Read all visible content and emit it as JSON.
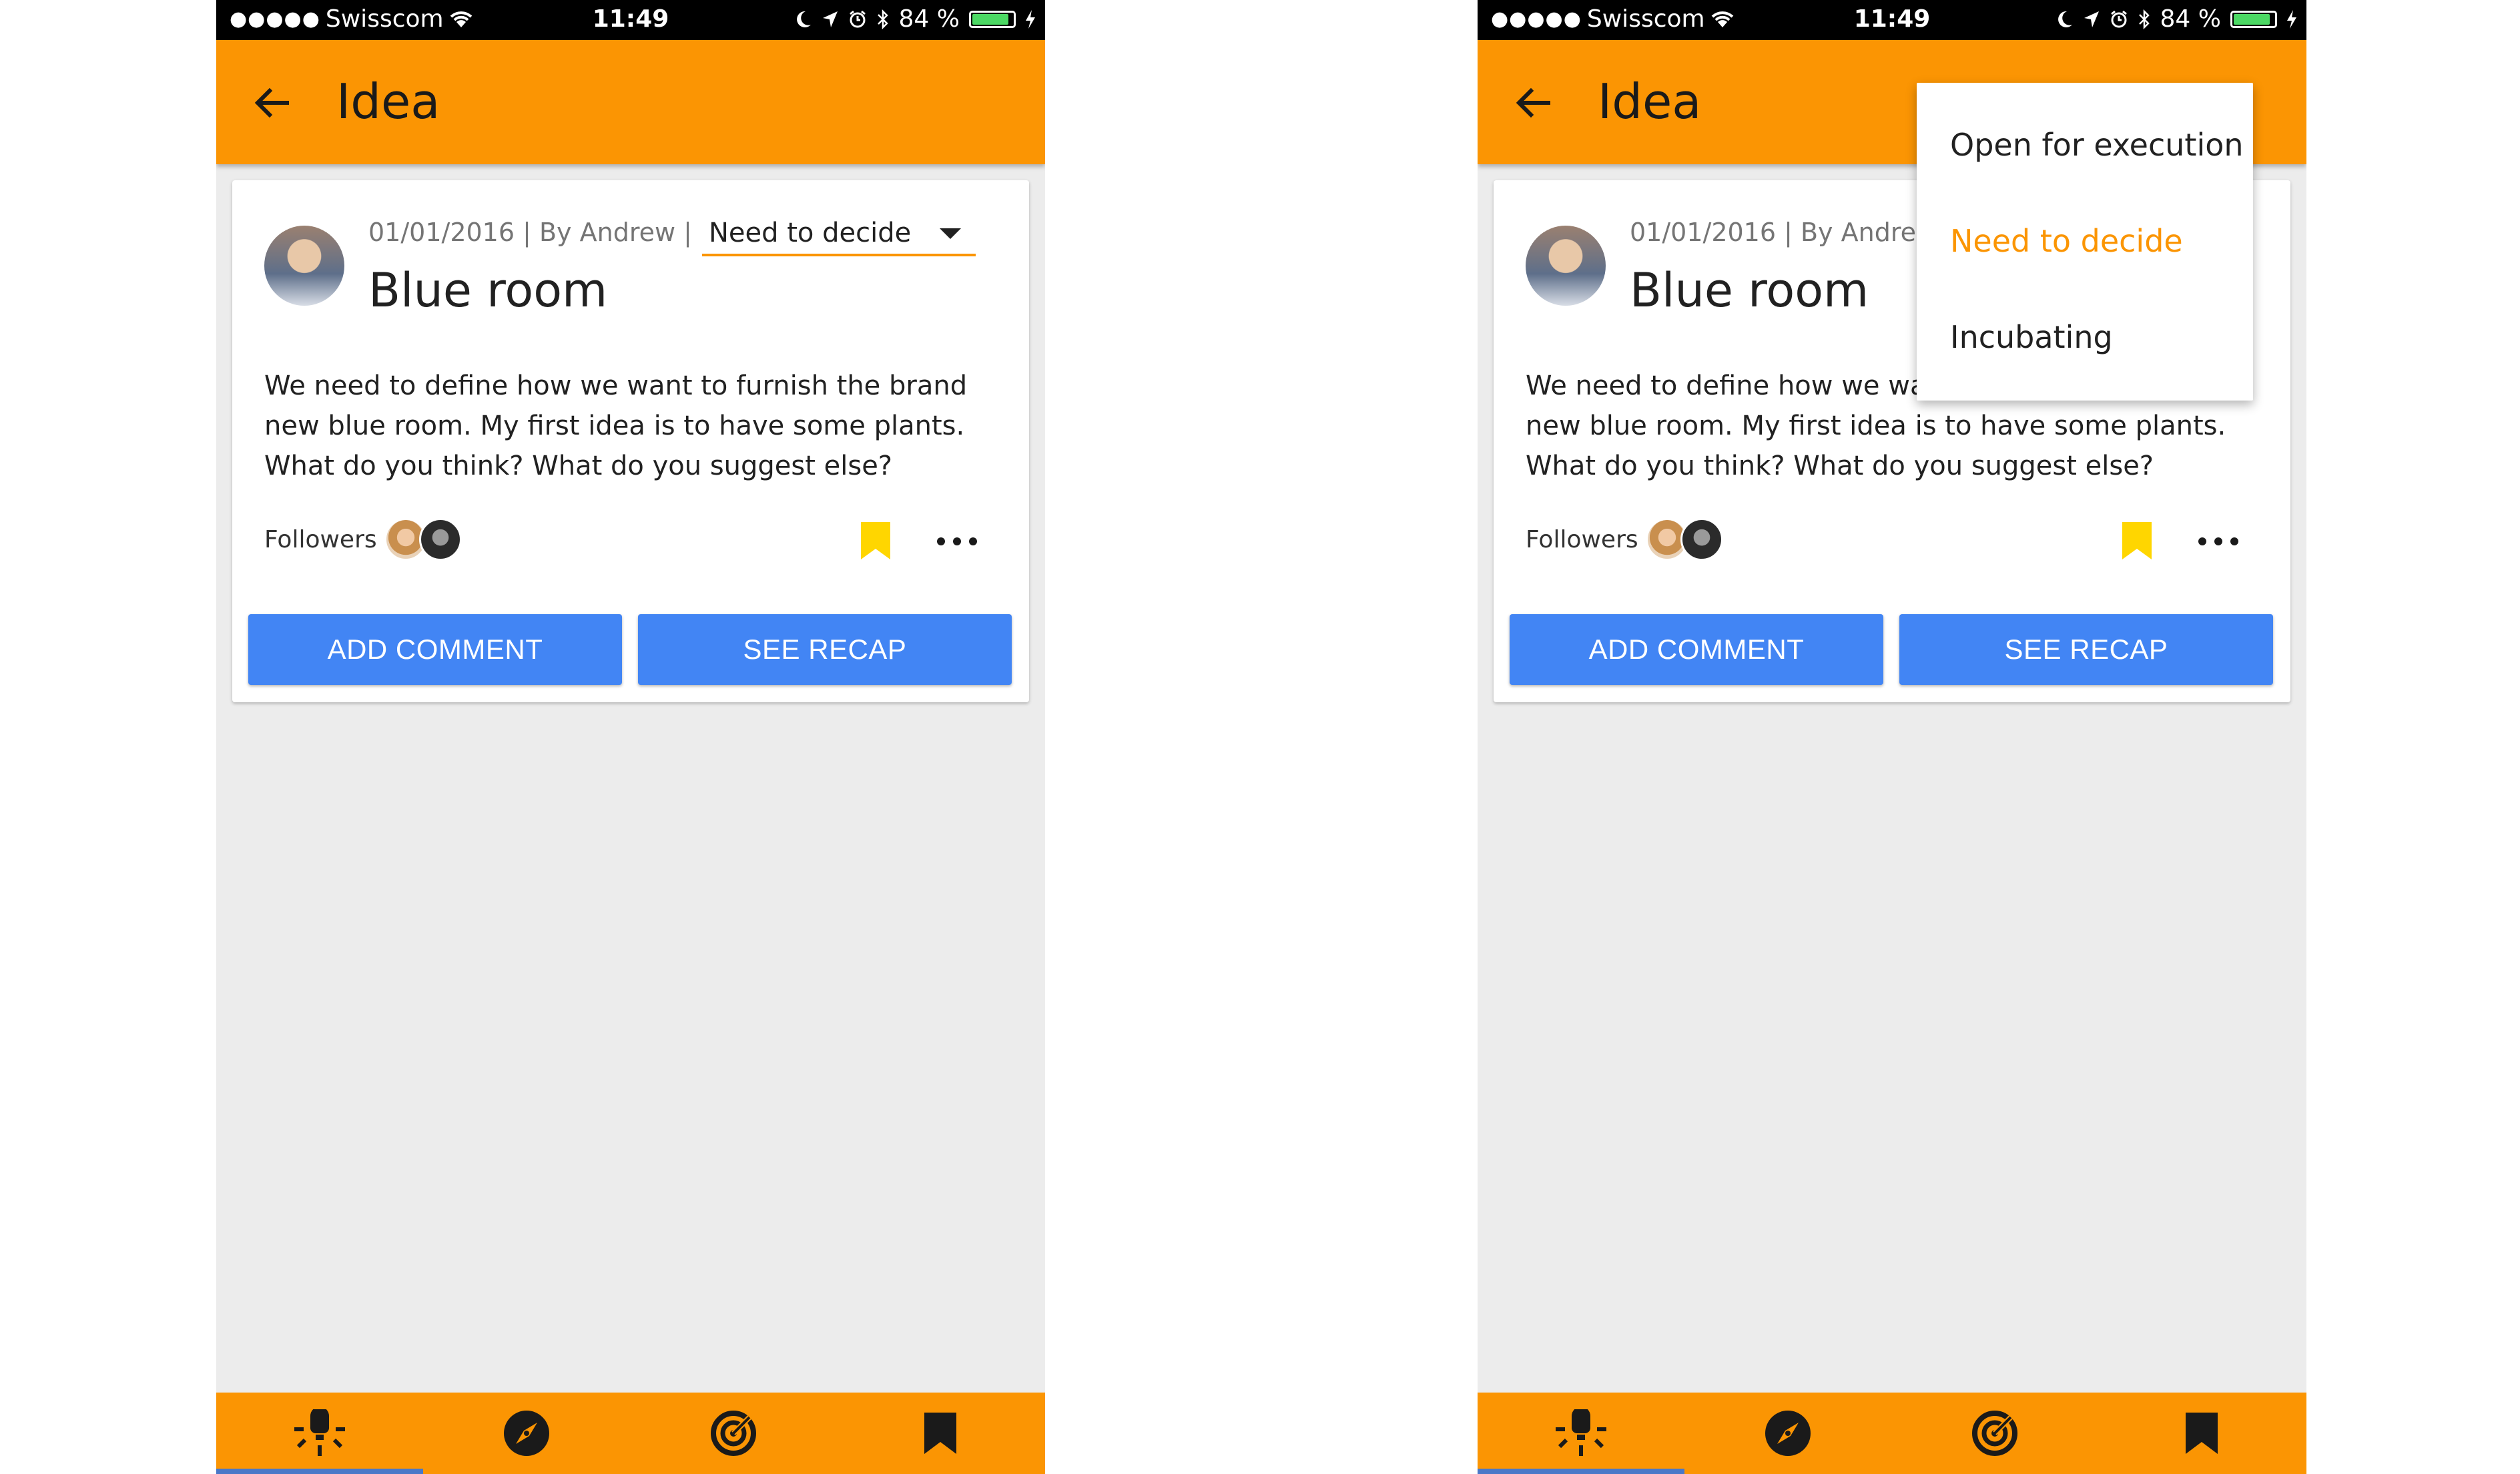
{
  "status_bar": {
    "signal_dots": "●●●●●",
    "carrier": "Swisscom",
    "time": "11:49",
    "battery_text": "84 %",
    "battery_level": 0.84,
    "icons": [
      "wifi-icon",
      "moon-icon",
      "location-arrow-icon",
      "alarm-icon",
      "bluetooth-icon",
      "battery-icon",
      "charging-bolt-icon"
    ]
  },
  "app_bar": {
    "back_icon": "arrow-left-icon",
    "title": "Idea"
  },
  "idea": {
    "meta": "01/01/2016 | By Andrew |",
    "status": "Need to decide",
    "title": "Blue room",
    "description": "We need to define how we want to furnish the brand new blue room. My first idea is to have some plants. What do you think? What do you suggest else?",
    "followers_label": "Followers",
    "followers_count": 2
  },
  "actions": {
    "add_comment": "ADD COMMENT",
    "see_recap": "SEE RECAP"
  },
  "status_menu": {
    "options": [
      "Open for execution",
      "Need to decide",
      "Incubating"
    ],
    "selected": "Need to decide"
  },
  "bottom_nav": {
    "items": [
      "lightbulb-icon",
      "compass-icon",
      "target-icon",
      "bookmark-icon"
    ],
    "active_index": 0
  },
  "colors": {
    "primary": "#fb9503",
    "button": "#4285f4",
    "bookmark": "#ffd600",
    "background": "#ececec",
    "nav_indicator": "#4a78c8"
  }
}
